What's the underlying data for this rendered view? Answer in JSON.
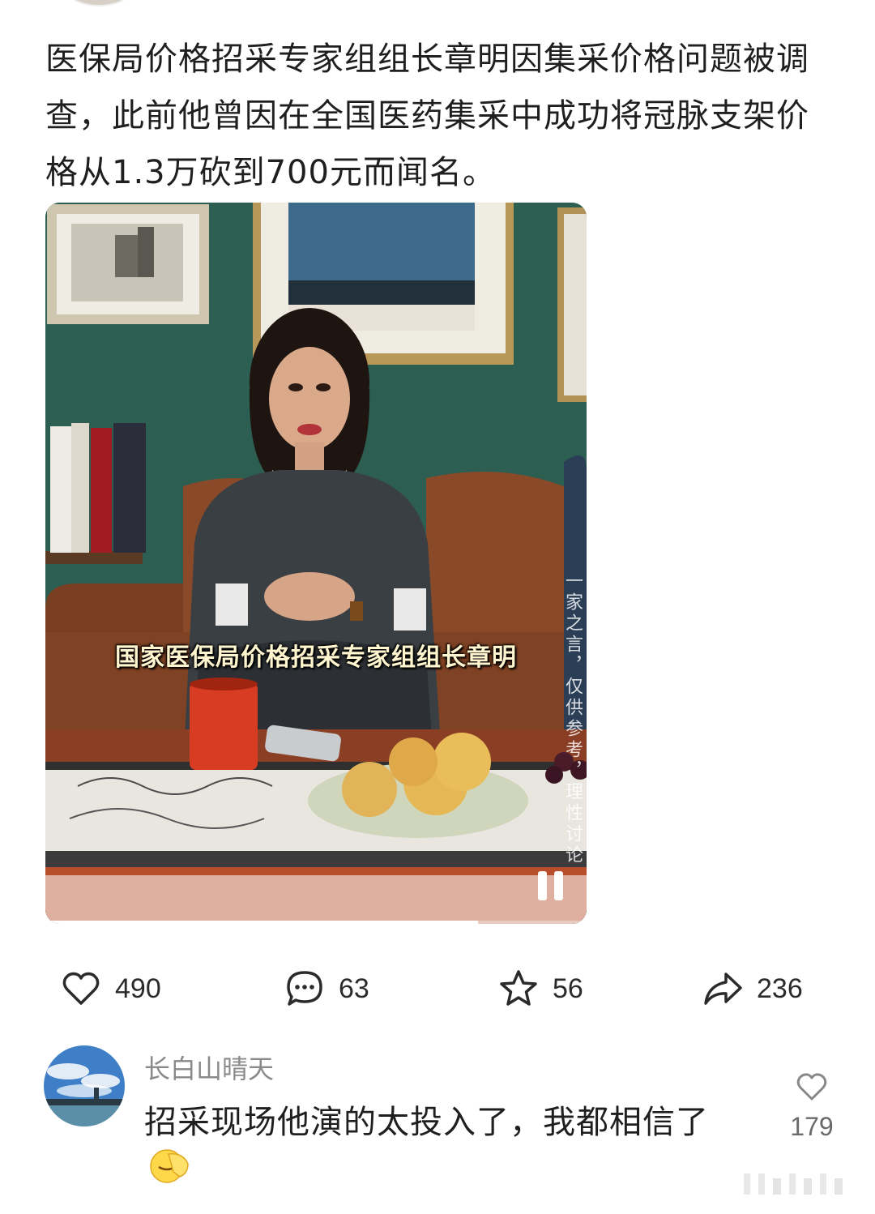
{
  "post": {
    "text": "医保局价格招采专家组组长章明因集采价格问题被调查，此前他曾因在全国医药集采中成功将冠脉支架价格从1.3万砍到700元而闻名。"
  },
  "video": {
    "subtitle": "国家医保局价格招采专家组组长章明",
    "vertical_note": "一家之言，仅供参考，理性讨论",
    "pause_icon": "pause-icon",
    "progress": 0.8
  },
  "actions": {
    "likes": "490",
    "comments": "63",
    "favorites": "56",
    "shares": "236"
  },
  "comment": {
    "user": "长白山晴天",
    "text": "招采现场他演的太投入了，我都相信了",
    "emoji": "facepalm-emoji",
    "likes": "179"
  },
  "colors": {
    "wall_green": "#2c5e52",
    "sofa_brown": "#8a4a2a",
    "text_dark": "#1f1f1f",
    "text_gray": "#8a8a8a"
  }
}
